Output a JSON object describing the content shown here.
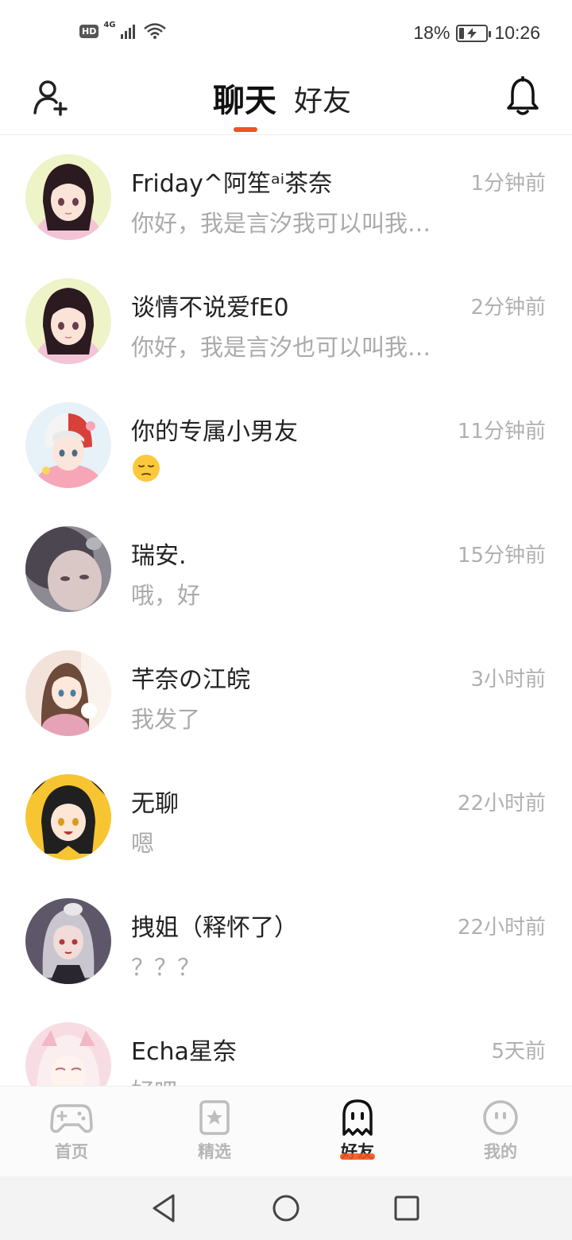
{
  "status_bar": {
    "hd_label": "HD",
    "network_label": "4G",
    "battery_percent": "18%",
    "battery_level": 0.18,
    "time": "10:26"
  },
  "header": {
    "tabs": [
      {
        "label": "聊天",
        "active": true
      },
      {
        "label": "好友",
        "active": false
      }
    ],
    "add_friend_icon": "add-user-icon",
    "bell_icon": "bell-icon",
    "accent_color": "#f0541e"
  },
  "chats": [
    {
      "name": "Friday^阿笙ᵃⁱ茶奈",
      "preview": "你好，我是言汐我可以叫我…",
      "time": "1分钟前"
    },
    {
      "name": "谈情不说爱fE0",
      "preview": "你好，我是言汐也可以叫我…",
      "time": "2分钟前"
    },
    {
      "name": "你的专属小男友",
      "preview": "😔",
      "time": "11分钟前"
    },
    {
      "name": "瑞安.",
      "preview": "哦，好",
      "time": "15分钟前"
    },
    {
      "name": "芊奈の江皖",
      "preview": "我发了",
      "time": "3小时前"
    },
    {
      "name": "无聊",
      "preview": "嗯",
      "time": "22小时前"
    },
    {
      "name": "拽姐（释怀了）",
      "preview": "？？？",
      "time": "22小时前"
    },
    {
      "name": "Echa星奈",
      "preview": "好吧",
      "time": "5天前"
    }
  ],
  "tab_bar": {
    "items": [
      {
        "label": "首页",
        "icon": "gamepad-icon",
        "active": false
      },
      {
        "label": "精选",
        "icon": "star-card-icon",
        "active": false
      },
      {
        "label": "好友",
        "icon": "ghost-icon",
        "active": true
      },
      {
        "label": "我的",
        "icon": "smiley-icon",
        "active": false
      }
    ]
  },
  "system_nav": {
    "back_icon": "triangle-back-icon",
    "home_icon": "circle-home-icon",
    "recents_icon": "square-recents-icon"
  }
}
